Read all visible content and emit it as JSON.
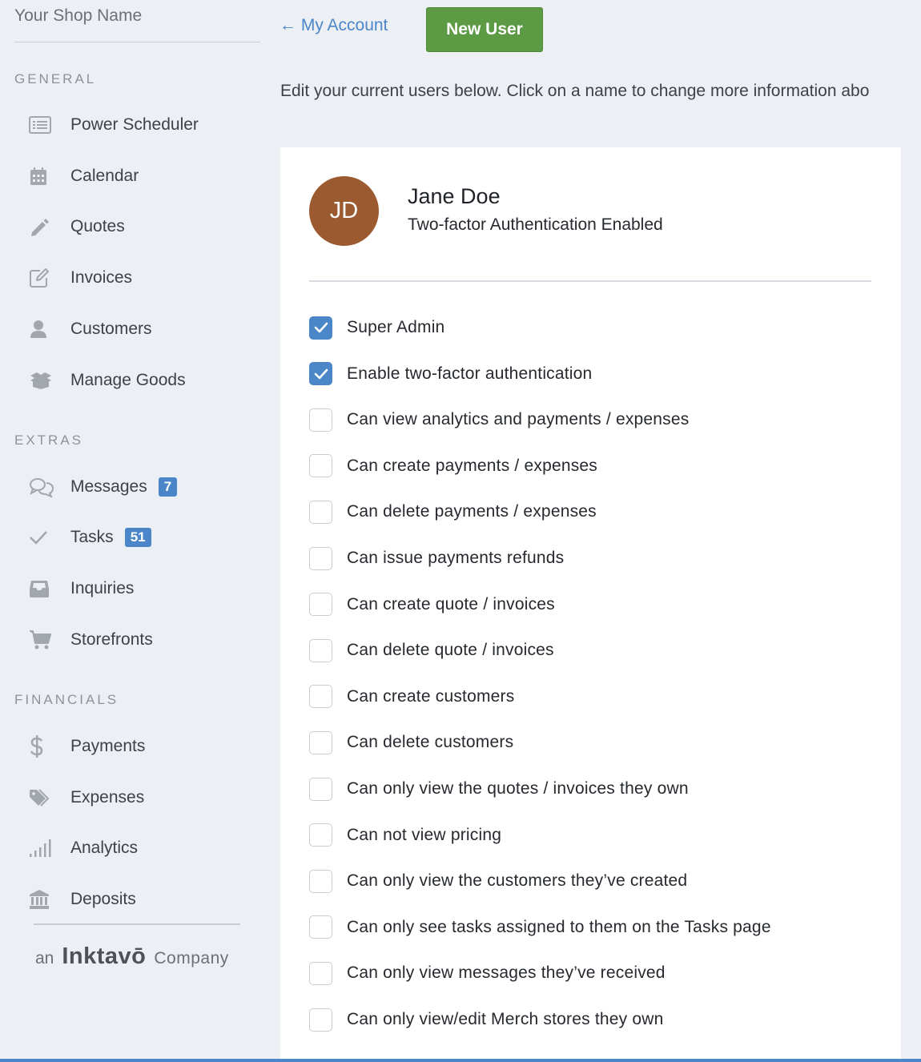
{
  "shop": {
    "name": "Your Shop Name"
  },
  "sections": {
    "general": "GENERAL",
    "extras": "EXTRAS",
    "financials": "FINANCIALS"
  },
  "nav": {
    "general": [
      {
        "label": "Power Scheduler",
        "icon": "list-icon"
      },
      {
        "label": "Calendar",
        "icon": "calendar-icon"
      },
      {
        "label": "Quotes",
        "icon": "pencil-icon"
      },
      {
        "label": "Invoices",
        "icon": "edit-icon"
      },
      {
        "label": "Customers",
        "icon": "person-icon"
      },
      {
        "label": "Manage Goods",
        "icon": "box-icon"
      }
    ],
    "extras": [
      {
        "label": "Messages",
        "icon": "chat-icon",
        "badge": "7"
      },
      {
        "label": "Tasks",
        "icon": "check-icon",
        "badge": "51"
      },
      {
        "label": "Inquiries",
        "icon": "inbox-icon"
      },
      {
        "label": "Storefronts",
        "icon": "cart-icon"
      }
    ],
    "financials": [
      {
        "label": "Payments",
        "icon": "dollar-icon"
      },
      {
        "label": "Expenses",
        "icon": "tags-icon"
      },
      {
        "label": "Analytics",
        "icon": "signal-icon"
      },
      {
        "label": "Deposits",
        "icon": "bank-icon"
      }
    ]
  },
  "footer": {
    "an": "an",
    "brand": "Inktavō",
    "company": "Company"
  },
  "top": {
    "back_label": "← My Account",
    "new_user_label": "New User",
    "intro": "Edit your current users below. Click on a name to change more information abo"
  },
  "user": {
    "initials": "JD",
    "name": "Jane Doe",
    "status": "Two-factor Authentication Enabled",
    "avatar_color": "#9b5a30"
  },
  "permissions": [
    {
      "label": "Super Admin",
      "checked": true
    },
    {
      "label": "Enable two-factor authentication",
      "checked": true
    },
    {
      "label": "Can view analytics and payments / expenses",
      "checked": false
    },
    {
      "label": "Can create payments / expenses",
      "checked": false
    },
    {
      "label": "Can delete payments / expenses",
      "checked": false
    },
    {
      "label": "Can issue payments refunds",
      "checked": false
    },
    {
      "label": "Can create quote / invoices",
      "checked": false
    },
    {
      "label": "Can delete quote / invoices",
      "checked": false
    },
    {
      "label": "Can create customers",
      "checked": false
    },
    {
      "label": "Can delete customers",
      "checked": false
    },
    {
      "label": "Can only view the quotes / invoices they own",
      "checked": false
    },
    {
      "label": "Can not view pricing",
      "checked": false
    },
    {
      "label": "Can only view the customers they’ve created",
      "checked": false
    },
    {
      "label": "Can only see tasks assigned to them on the Tasks page",
      "checked": false
    },
    {
      "label": "Can only view messages they’ve received",
      "checked": false
    },
    {
      "label": "Can only view/edit Merch stores they own",
      "checked": false
    }
  ],
  "colors": {
    "accent": "#4a86c8",
    "button_green": "#5c9a43"
  }
}
